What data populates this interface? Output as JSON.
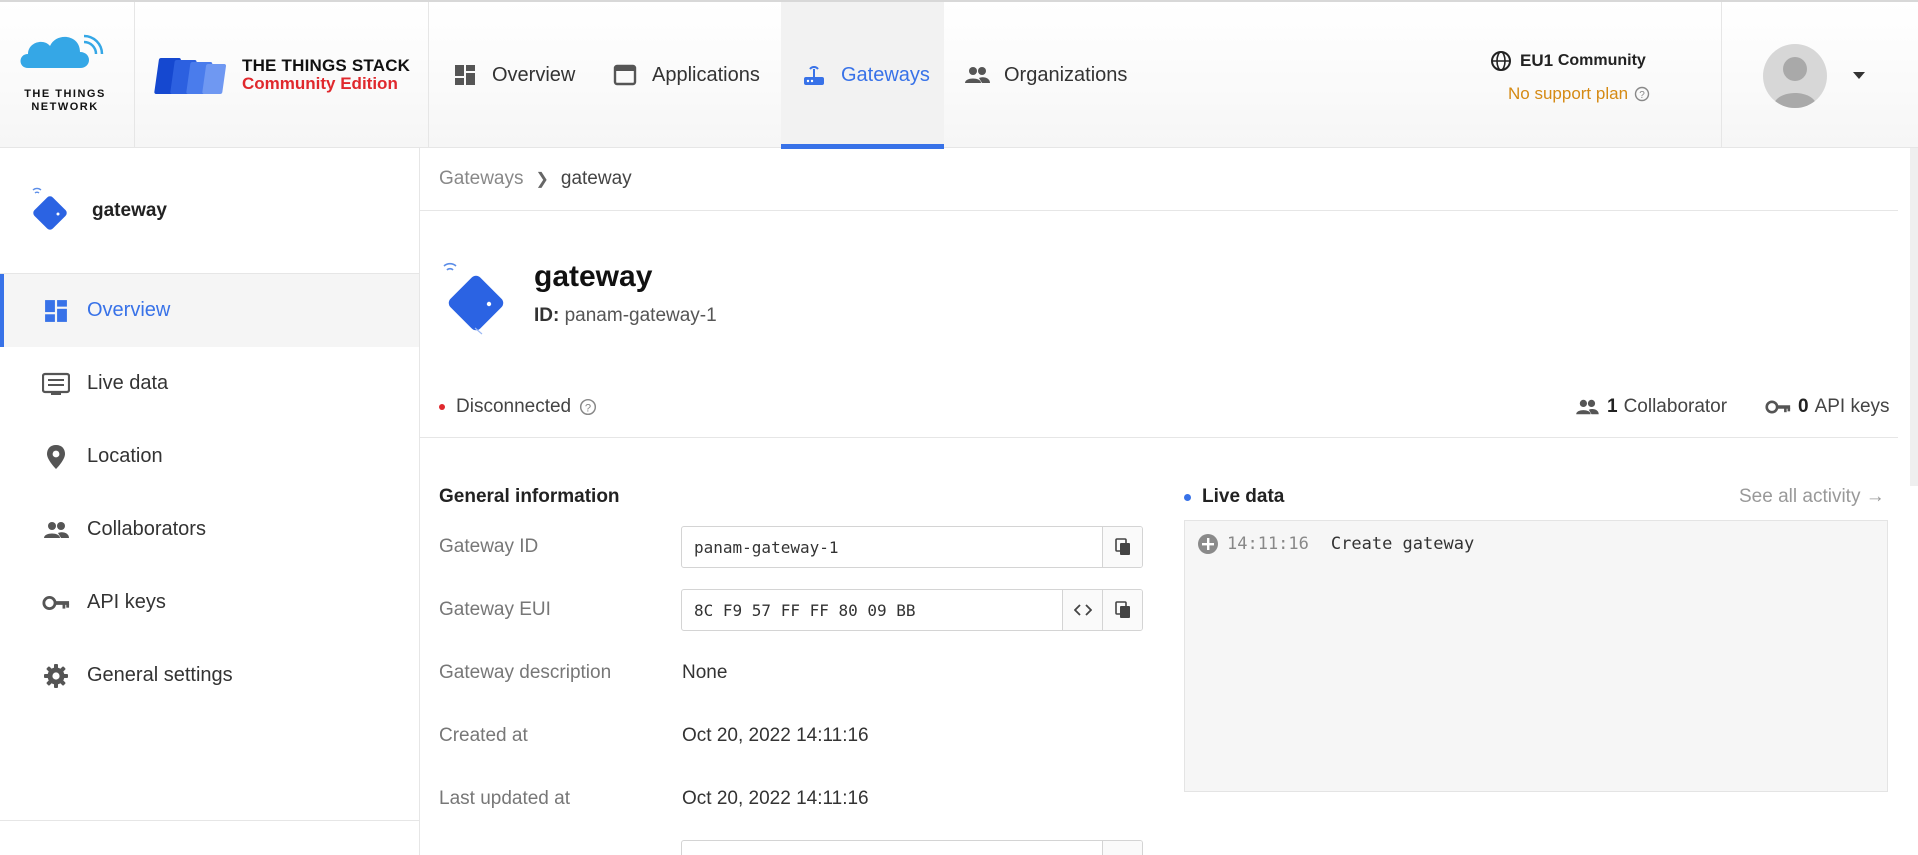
{
  "header": {
    "ttn_logo_text": "THE THINGS NETWORK",
    "stack_title": "THE THINGS STACK",
    "stack_subtitle": "Community Edition",
    "nav": [
      {
        "label": "Overview",
        "icon": "overview-icon"
      },
      {
        "label": "Applications",
        "icon": "applications-icon"
      },
      {
        "label": "Gateways",
        "icon": "gateway-icon",
        "active": true
      },
      {
        "label": "Organizations",
        "icon": "organizations-icon"
      }
    ],
    "region": "EU1",
    "region_tier": "Community",
    "support_plan": "No support plan"
  },
  "sidebar": {
    "title": "gateway",
    "items": [
      {
        "label": "Overview",
        "icon": "overview-icon",
        "active": true
      },
      {
        "label": "Live data",
        "icon": "live-data-icon"
      },
      {
        "label": "Location",
        "icon": "location-pin-icon"
      },
      {
        "label": "Collaborators",
        "icon": "collaborators-icon"
      },
      {
        "label": "API keys",
        "icon": "key-icon"
      },
      {
        "label": "General settings",
        "icon": "gear-icon"
      }
    ]
  },
  "breadcrumb": {
    "parent": "Gateways",
    "current": "gateway"
  },
  "gateway": {
    "name": "gateway",
    "id_label": "ID:",
    "id_value": "panam-gateway-1",
    "status": "Disconnected",
    "collaborators_count": "1",
    "collaborators_label": "Collaborator",
    "api_keys_count": "0",
    "api_keys_label": "API keys"
  },
  "general_info": {
    "title": "General information",
    "gateway_id_label": "Gateway ID",
    "gateway_id_value": "panam-gateway-1",
    "gateway_eui_label": "Gateway EUI",
    "gateway_eui_value": "8C F9 57 FF FF 80 09 BB",
    "description_label": "Gateway description",
    "description_value": "None",
    "created_label": "Created at",
    "created_value": "Oct 20, 2022 14:11:16",
    "updated_label": "Last updated at",
    "updated_value": "Oct 20, 2022 14:11:16"
  },
  "live_data": {
    "title": "Live data",
    "see_all": "See all activity →",
    "events": [
      {
        "time": "14:11:16",
        "text": "Create gateway"
      }
    ]
  },
  "colors": {
    "accent": "#3872e8",
    "brand_red": "#e0282d",
    "support_orange": "#d58a14"
  }
}
